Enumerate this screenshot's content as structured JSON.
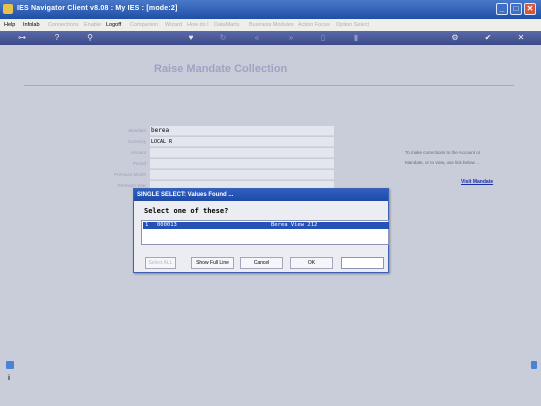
{
  "window": {
    "title": "IES Navigator Client v8.08 : My IES :      [mode:2]",
    "minimize_glyph": "_",
    "maximize_glyph": "□",
    "close_glyph": "✕"
  },
  "menu": {
    "items": [
      {
        "label": "Help",
        "enabled": true
      },
      {
        "label": "Infolab",
        "enabled": true
      },
      {
        "label": "Connections",
        "enabled": false
      },
      {
        "label": "Enable",
        "enabled": false
      },
      {
        "label": "Logoff",
        "enabled": true
      },
      {
        "label": "Companion",
        "enabled": false
      },
      {
        "label": "Wizard",
        "enabled": false
      },
      {
        "label": "How do I",
        "enabled": false
      },
      {
        "label": "DataMarts",
        "enabled": false
      },
      {
        "label": "Business Modules",
        "enabled": false
      },
      {
        "label": "Action Focus",
        "enabled": false
      },
      {
        "label": "Option Select",
        "enabled": false
      }
    ]
  },
  "toolbar": {
    "icons": [
      {
        "name": "key-icon",
        "glyph": "⊶",
        "enabled": true
      },
      {
        "name": "help-icon",
        "glyph": "?",
        "enabled": true
      },
      {
        "name": "search-icon",
        "glyph": "⚲",
        "enabled": true
      },
      {
        "name": "heart-icon",
        "glyph": "♥",
        "enabled": true
      },
      {
        "name": "refresh-icon",
        "glyph": "↻",
        "enabled": false
      },
      {
        "name": "back-icon",
        "glyph": "«",
        "enabled": false
      },
      {
        "name": "forward-icon",
        "glyph": "»",
        "enabled": false
      },
      {
        "name": "page-icon",
        "glyph": "▯",
        "enabled": false
      },
      {
        "name": "trash-icon",
        "glyph": "▮",
        "enabled": false
      },
      {
        "name": "settings-icon",
        "glyph": "⚙",
        "enabled": true
      },
      {
        "name": "check-icon",
        "glyph": "✔",
        "enabled": true
      },
      {
        "name": "cancel-icon",
        "glyph": "✕",
        "enabled": true
      }
    ]
  },
  "page": {
    "title": "Raise Mandate Collection"
  },
  "form": {
    "fields": [
      {
        "label": "Mandate",
        "value": "berea"
      },
      {
        "label": "Currency",
        "value": "LOCAL R"
      },
      {
        "label": "Amount",
        "value": ""
      },
      {
        "label": "Period",
        "value": ""
      },
      {
        "label": "Premium Month",
        "value": ""
      },
      {
        "label": "Premium Year",
        "value": ""
      }
    ]
  },
  "help": {
    "line1": "To make corrections to the Account or",
    "line2": "Mandate, or to view, use link below ...",
    "link": "Visit Mandate"
  },
  "dialog": {
    "title": "SINGLE SELECT: Values Found ...",
    "prompt": "Select one of these?",
    "rows": [
      {
        "index": "1",
        "code": "000013",
        "description": "Berea View 212"
      }
    ],
    "buttons": {
      "select_all": "Select ALL",
      "show_full_line": "Show Full Line",
      "cancel": "Cancel",
      "ok": "OK"
    },
    "input_value": ""
  },
  "footer": {
    "side_glyph": "i"
  }
}
